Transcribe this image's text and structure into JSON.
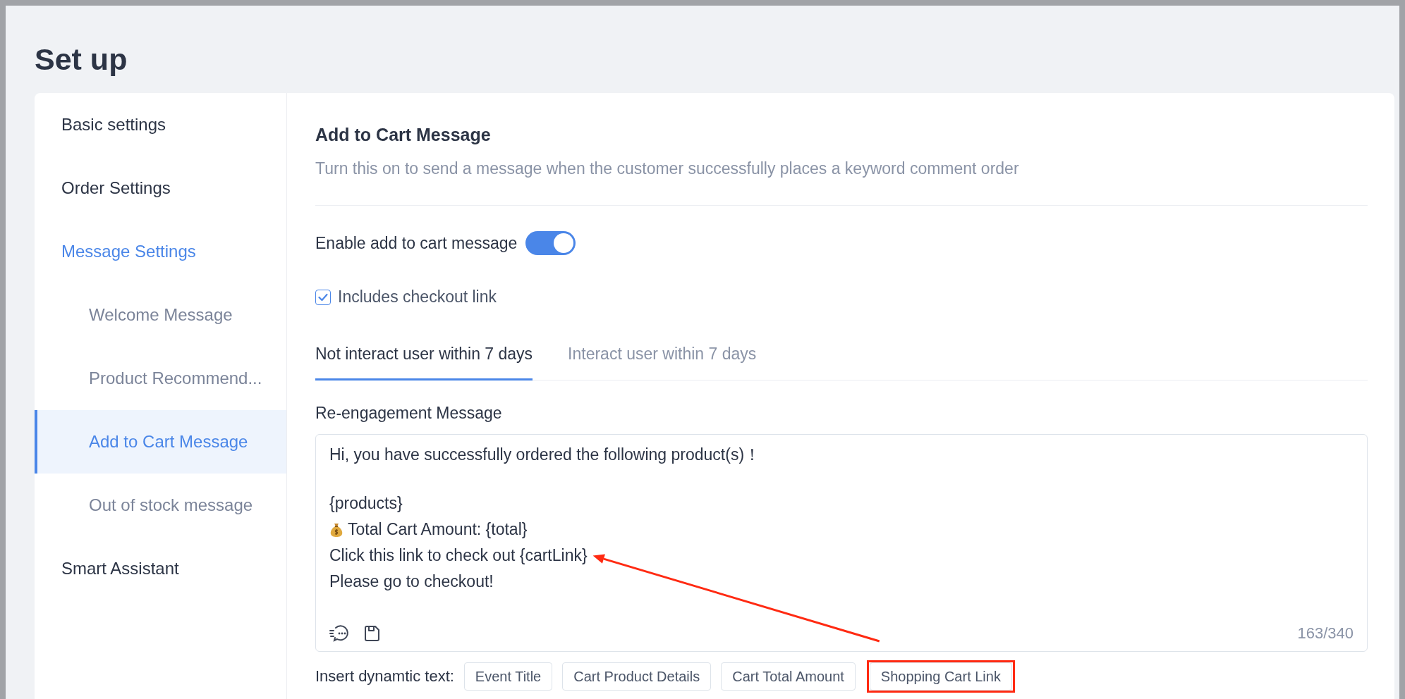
{
  "page": {
    "title": "Set up"
  },
  "sidebar": {
    "items": [
      {
        "label": "Basic settings",
        "selected": false
      },
      {
        "label": "Order Settings",
        "selected": false
      },
      {
        "label": "Message Settings",
        "selected": false,
        "children": [
          {
            "label": "Welcome Message",
            "selected": false
          },
          {
            "label": "Product Recommend...",
            "selected": false
          },
          {
            "label": "Add to Cart Message",
            "selected": true
          },
          {
            "label": "Out of stock message",
            "selected": false
          }
        ]
      },
      {
        "label": "Smart Assistant",
        "selected": false
      }
    ]
  },
  "section": {
    "title": "Add to Cart Message",
    "description": "Turn this on to send a message when the customer successfully places a keyword comment order"
  },
  "toggle": {
    "label": "Enable add to cart message",
    "on": true
  },
  "checkbox": {
    "label": "Includes checkout link",
    "checked": true
  },
  "tabs": [
    {
      "label": "Not interact user within 7 days",
      "selected": true
    },
    {
      "label": "Interact user within 7 days",
      "selected": false
    }
  ],
  "message": {
    "label": "Re-engagement Message",
    "lines": [
      {
        "text": "Hi, you have successfully ordered the following product(s)！",
        "space_after": true
      },
      {
        "text": "{products}"
      },
      {
        "text": "Total Cart Amount: {total}",
        "kind": "amount"
      },
      {
        "text": "Click this link to check out {cartLink}",
        "pointed_at": true
      },
      {
        "text": "Please go to checkout!"
      }
    ],
    "counter": "163/340"
  },
  "dynamic_text": {
    "label": "Insert dynamtic text:",
    "buttons": [
      {
        "label": "Event Title",
        "highlighted": false
      },
      {
        "label": "Cart Product Details",
        "highlighted": false
      },
      {
        "label": "Cart Total Amount",
        "highlighted": false
      },
      {
        "label": "Shopping Cart Link",
        "highlighted": true
      }
    ]
  }
}
